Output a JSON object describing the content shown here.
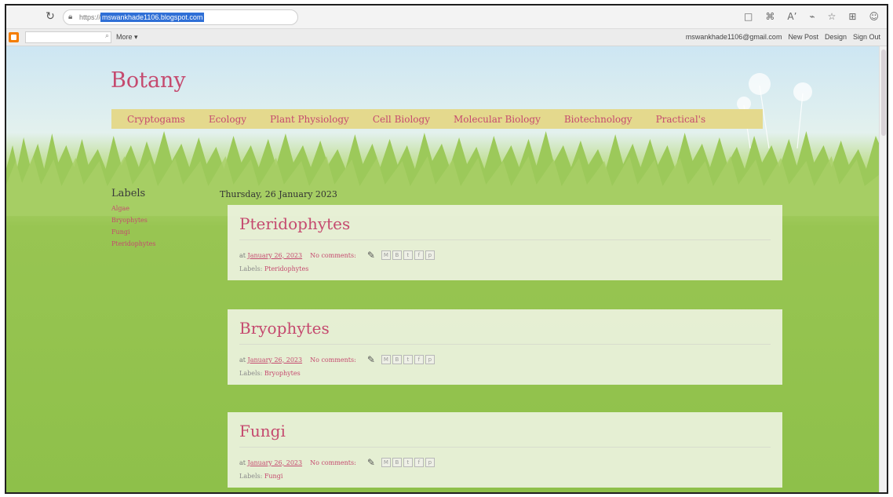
{
  "browser": {
    "url_prefix": "https://",
    "url_highlight": "mswankhade1106.blogspot.com",
    "icons": [
      "reader-icon",
      "translate-icon",
      "read-aloud-icon",
      "extension-icon",
      "favorite-icon",
      "collections-icon",
      "profile-icon"
    ]
  },
  "navbar": {
    "more_label": "More ▾",
    "account": "mswankhade1106@gmail.com",
    "new_post": "New Post",
    "design": "Design",
    "sign_out": "Sign Out"
  },
  "blog": {
    "title": "Botany",
    "tabs": [
      "Cryptogams",
      "Ecology",
      "Plant Physiology",
      "Cell Biology",
      "Molecular Biology",
      "Biotechnology",
      "Practical's"
    ]
  },
  "sidebar": {
    "heading": "Labels",
    "labels": [
      "Algae",
      "Bryophytes",
      "Fungi",
      "Pteridophytes"
    ]
  },
  "main": {
    "date_header": "Thursday, 26 January 2023",
    "posts": [
      {
        "title": "Pteridophytes",
        "at": "at",
        "date": "January 26, 2023",
        "comments": "No comments:",
        "labels_prefix": "Labels:",
        "label": "Pteridophytes"
      },
      {
        "title": "Bryophytes",
        "at": "at",
        "date": "January 26, 2023",
        "comments": "No comments:",
        "labels_prefix": "Labels:",
        "label": "Bryophytes"
      },
      {
        "title": "Fungi",
        "at": "at",
        "date": "January 26, 2023",
        "comments": "No comments:",
        "labels_prefix": "Labels:",
        "label": "Fungi"
      }
    ]
  },
  "colors": {
    "accent": "#c54a6f",
    "tab_bar": "#e4d98d",
    "grass": "#8ec04a",
    "sky": "#cde6f3"
  }
}
